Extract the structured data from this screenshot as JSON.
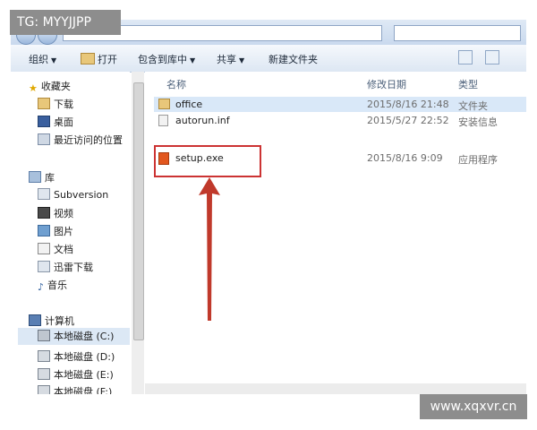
{
  "toolbar": {
    "organize": "组织",
    "open": "打开",
    "include_library": "包含到库中",
    "share": "共享",
    "new_folder": "新建文件夹"
  },
  "sidebar": {
    "favorites": {
      "header": "收藏夹",
      "items": [
        "下载",
        "桌面",
        "最近访问的位置"
      ]
    },
    "libraries": {
      "header": "库",
      "items": [
        "Subversion",
        "视频",
        "图片",
        "文档",
        "迅雷下载",
        "音乐"
      ]
    },
    "computer": {
      "header": "计算机",
      "drives": [
        "本地磁盘 (C:)",
        "本地磁盘 (D:)",
        "本地磁盘 (E:)",
        "本地磁盘 (F:)"
      ]
    }
  },
  "columns": {
    "name": "名称",
    "date": "修改日期",
    "type": "类型"
  },
  "files": [
    {
      "name": "office",
      "date": "2015/8/16 21:48",
      "type": "文件夹",
      "icon": "folder-icon",
      "selected": true
    },
    {
      "name": "autorun.inf",
      "date": "2015/5/27 22:52",
      "type": "安装信息",
      "icon": "settings-file-icon",
      "selected": false
    },
    {
      "name": "setup.exe",
      "date": "2015/8/16 9:09",
      "type": "应用程序",
      "icon": "office-app-icon",
      "selected": false
    }
  ],
  "watermarks": {
    "tg": "TG: MYYJJPP",
    "site": "www.xqxvr.cn"
  },
  "colors": {
    "highlight": "#cc3333",
    "arrow": "#c0392b",
    "selection": "#d9e8f8"
  }
}
